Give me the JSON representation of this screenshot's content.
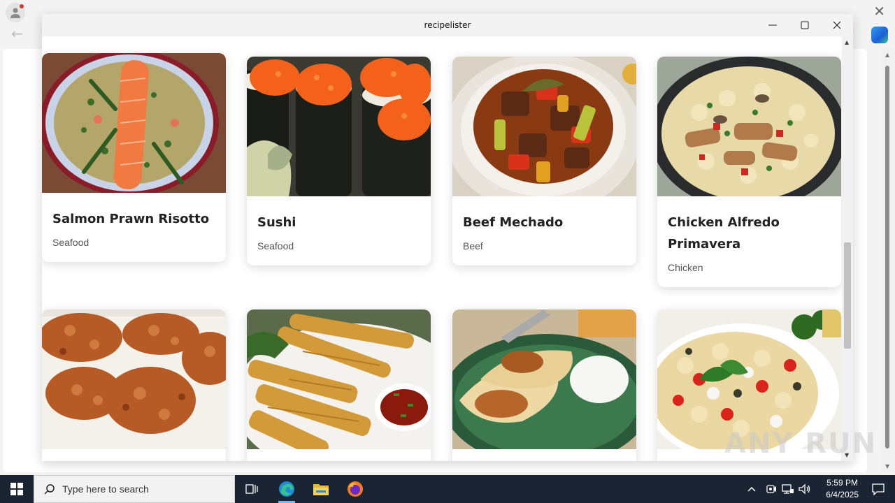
{
  "window": {
    "title": "recipelister"
  },
  "recipes": [
    {
      "name": "Salmon Prawn Risotto",
      "category": "Seafood"
    },
    {
      "name": "Sushi",
      "category": "Seafood"
    },
    {
      "name": "Beef Mechado",
      "category": "Beef"
    },
    {
      "name": "Chicken Alfredo Primavera",
      "category": "Chicken"
    },
    {
      "name": "",
      "category": ""
    },
    {
      "name": "",
      "category": ""
    },
    {
      "name": "",
      "category": ""
    },
    {
      "name": "",
      "category": ""
    }
  ],
  "taskbar": {
    "search_placeholder": "Type here to search",
    "time": "5:59 PM",
    "date": "6/4/2025"
  },
  "watermark": "ANY RUN",
  "icons": [
    "windows-start-icon",
    "search-icon",
    "task-view-icon",
    "edge-icon",
    "file-explorer-icon",
    "firefox-icon",
    "chevron-up-icon",
    "meet-now-icon",
    "network-icon",
    "volume-icon",
    "notification-icon",
    "minimize-icon",
    "maximize-icon",
    "close-icon"
  ],
  "colors": {
    "taskbar": "#1b2433",
    "titlebar": "#f3f3f3",
    "card_title": "#222222"
  }
}
